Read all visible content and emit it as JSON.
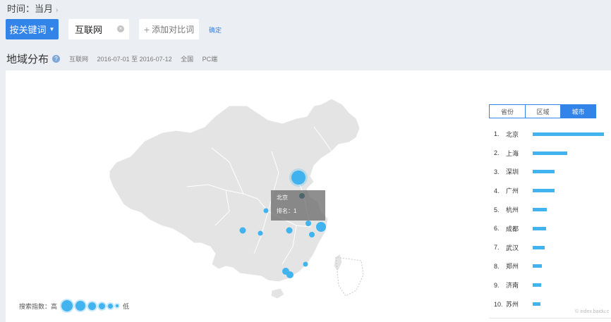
{
  "time_filter": {
    "label": "时间：当月"
  },
  "toolbar": {
    "keyword_button": "按关键词",
    "term": "互联网",
    "add_label": "添加对比词",
    "confirm": "确定"
  },
  "section": {
    "title": "地域分布",
    "term": "互联网",
    "date_range": "2016-07-01 至 2016-07-12",
    "region": "全国",
    "device": "PC端"
  },
  "tooltip": {
    "city": "北京",
    "rank_label": "排名：1"
  },
  "legend": {
    "label": "搜索指数：高",
    "low": "低"
  },
  "tabs": [
    {
      "label": "省份",
      "active": false
    },
    {
      "label": "区域",
      "active": false
    },
    {
      "label": "城市",
      "active": true
    }
  ],
  "ranking": [
    {
      "no": "1.",
      "city": "北京",
      "value": 100
    },
    {
      "no": "2.",
      "city": "上海",
      "value": 49
    },
    {
      "no": "3.",
      "city": "深圳",
      "value": 31
    },
    {
      "no": "4.",
      "city": "广州",
      "value": 31
    },
    {
      "no": "5.",
      "city": "杭州",
      "value": 20
    },
    {
      "no": "6.",
      "city": "成都",
      "value": 19
    },
    {
      "no": "7.",
      "city": "武汉",
      "value": 17
    },
    {
      "no": "8.",
      "city": "郑州",
      "value": 13
    },
    {
      "no": "9.",
      "city": "济南",
      "value": 12
    },
    {
      "no": "10.",
      "city": "苏州",
      "value": 11
    }
  ],
  "watermark": "© index.baidu.c",
  "colors": {
    "accent": "#3384e8",
    "bubble": "#41b3ee",
    "map_fill": "#e4e4e4",
    "map_stroke": "#ffffff"
  }
}
